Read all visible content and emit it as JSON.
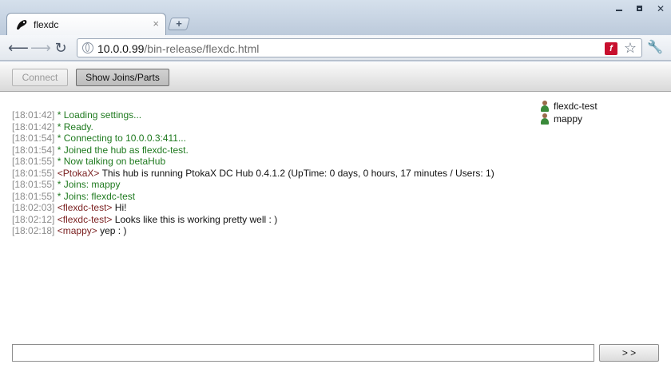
{
  "browser": {
    "tab_title": "flexdc",
    "tab_close_glyph": "×",
    "new_tab_glyph": "+",
    "url_host": "10.0.0.99",
    "url_path": "/bin-release/flexdc.html",
    "icons": [
      "back-arrow-icon",
      "forward-arrow-icon",
      "reload-icon",
      "globe-icon",
      "flash-icon",
      "star-icon",
      "wrench-icon"
    ]
  },
  "toolbar": {
    "connect_label": "Connect",
    "joins_label": "Show Joins/Parts"
  },
  "chat": [
    {
      "ts": "[18:01:42]",
      "text": "* Loading settings..."
    },
    {
      "ts": "[18:01:42]",
      "text": "* Ready."
    },
    {
      "ts": "[18:01:54]",
      "text": "* Connecting to 10.0.0.3:411..."
    },
    {
      "ts": "[18:01:54]",
      "text": "* Joined the hub as flexdc-test."
    },
    {
      "ts": "[18:01:55]",
      "text": "* Now talking on betaHub"
    },
    {
      "ts": "[18:01:55]",
      "nick": "<PtokaX>",
      "text": "This hub is running PtokaX DC Hub 0.4.1.2 (UpTime: 0 days, 0 hours, 17 minutes / Users: 1)"
    },
    {
      "ts": "[18:01:55]",
      "text": "* Joins: mappy"
    },
    {
      "ts": "[18:01:55]",
      "text": "* Joins: flexdc-test"
    },
    {
      "ts": "[18:02:03]",
      "nick": "<flexdc-test>",
      "text": "Hi!"
    },
    {
      "ts": "[18:02:12]",
      "nick": "<flexdc-test>",
      "text": "Looks like this is working pretty well  : )"
    },
    {
      "ts": "[18:02:18]",
      "nick": "<mappy>",
      "text": "yep : )"
    }
  ],
  "users": [
    "flexdc-test",
    "mappy"
  ],
  "input": {
    "value": "",
    "send_label": "> >"
  },
  "colors": {
    "timestamp": "#8c8c8c",
    "system_message": "#1f7a1f",
    "nick": "#7a1f1f"
  }
}
